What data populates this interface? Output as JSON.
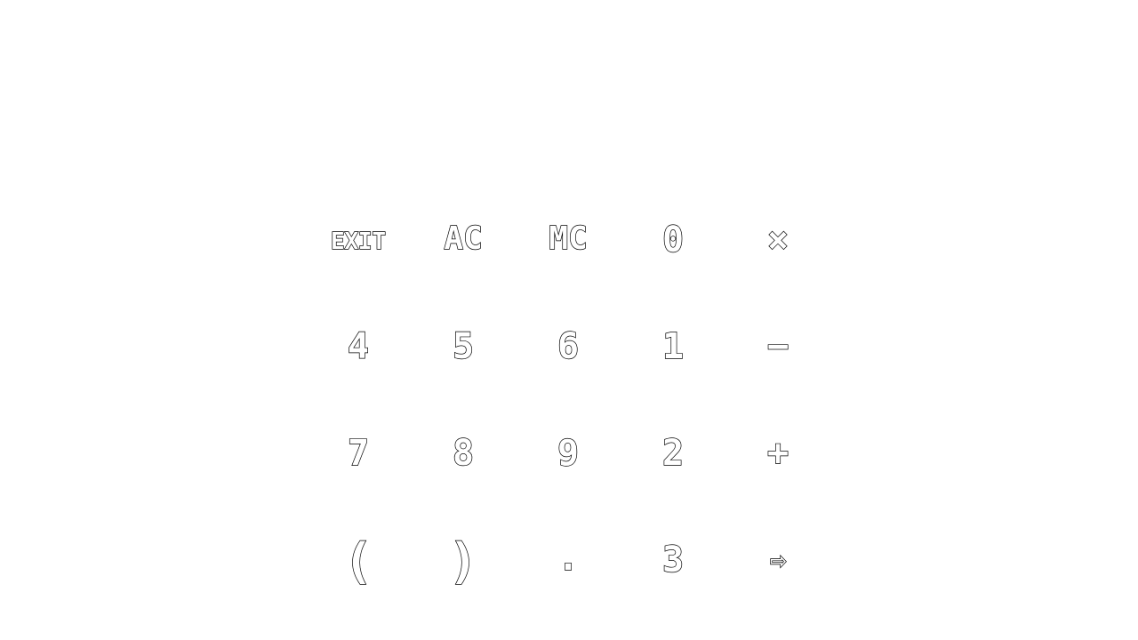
{
  "display": {
    "expression": ""
  },
  "keypad": {
    "rows": [
      [
        {
          "label": "EXIT",
          "icon": "exit-text",
          "name": "exit-button"
        },
        {
          "label": "AC",
          "icon": "all-clear-text",
          "name": "all-clear-button"
        },
        {
          "label": "MC",
          "icon": "memory-clear-text",
          "name": "memory-clear-button"
        },
        {
          "label": "0",
          "icon": "digit-0",
          "name": "digit-0-button"
        },
        {
          "label": "×",
          "icon": "multiply-icon",
          "name": "multiply-button"
        }
      ],
      [
        {
          "label": "4",
          "icon": "digit-4",
          "name": "digit-4-button"
        },
        {
          "label": "5",
          "icon": "digit-5",
          "name": "digit-5-button"
        },
        {
          "label": "6",
          "icon": "digit-6",
          "name": "digit-6-button"
        },
        {
          "label": "1",
          "icon": "digit-1",
          "name": "digit-1-button"
        },
        {
          "label": "−",
          "icon": "minus-icon",
          "name": "subtract-button"
        }
      ],
      [
        {
          "label": "7",
          "icon": "digit-7",
          "name": "digit-7-button"
        },
        {
          "label": "8",
          "icon": "digit-8",
          "name": "digit-8-button"
        },
        {
          "label": "9",
          "icon": "digit-9",
          "name": "digit-9-button"
        },
        {
          "label": "2",
          "icon": "digit-2",
          "name": "digit-2-button"
        },
        {
          "label": "+",
          "icon": "plus-icon",
          "name": "add-button"
        }
      ],
      [
        {
          "label": "(",
          "icon": "open-paren",
          "name": "open-paren-button"
        },
        {
          "label": ")",
          "icon": "close-paren",
          "name": "close-paren-button"
        },
        {
          "label": ".",
          "icon": "decimal-point",
          "name": "decimal-point-button"
        },
        {
          "label": "3",
          "icon": "digit-3",
          "name": "digit-3-button"
        },
        {
          "label": "⇨",
          "icon": "enter-arrow-icon",
          "name": "enter-button"
        }
      ]
    ]
  },
  "colors": {
    "background": "#ffffff",
    "glyph_outline": "#000000",
    "glyph_fill": "#ffffff"
  }
}
